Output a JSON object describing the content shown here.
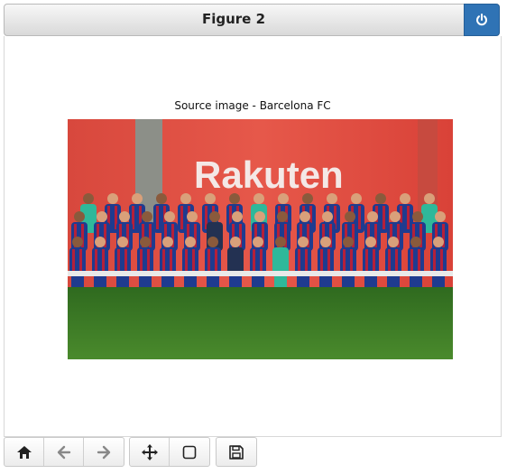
{
  "window": {
    "title": "Figure 2",
    "power_icon": "power-icon"
  },
  "figure": {
    "title": "Source image - Barcelona FC",
    "image": {
      "banner_text": "Rakuten",
      "banner_color": "#e0473c",
      "pitch_color": "#3f7a26",
      "kit_blue": "#1f3b8f",
      "kit_red": "#b4203a",
      "keeper_green": "#2fb89a"
    }
  },
  "toolbar": {
    "groups": [
      {
        "buttons": [
          {
            "icon": "home-icon"
          },
          {
            "icon": "back-arrow-icon"
          },
          {
            "icon": "forward-arrow-icon"
          }
        ]
      },
      {
        "buttons": [
          {
            "icon": "pan-move-icon"
          },
          {
            "icon": "zoom-rect-icon"
          }
        ]
      },
      {
        "buttons": [
          {
            "icon": "save-icon"
          }
        ]
      }
    ]
  }
}
